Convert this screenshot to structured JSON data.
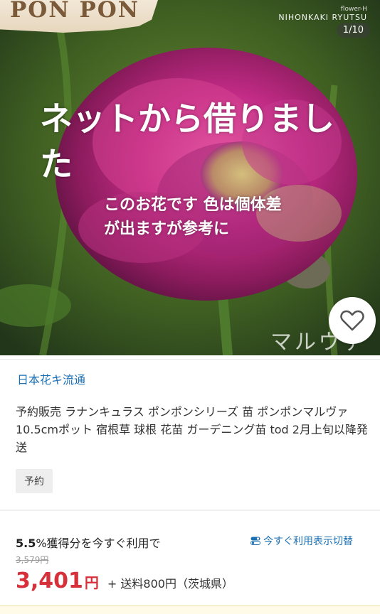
{
  "hero": {
    "brand": "PON PON",
    "shop_sub": "flower-H",
    "shop_name": "NIHONKAKI RYUTSU",
    "counter": "1/10",
    "overlay_big": "ネットから借りました",
    "overlay_small": "このお花です 色は個体差が出ますが参考に",
    "watermark": "マルヴァ",
    "fav_icon": "heart-icon"
  },
  "product": {
    "store_name": "日本花キ流通",
    "title": "予約販売 ラナンキュラス ポンポンシリーズ 苗 ポンポンマルヴァ 10.5cmポット 宿根草 球根 花苗 ガーデニング苗 tod 2月上旬以降発送",
    "badge": "予約"
  },
  "pricing": {
    "points_pct": "5.5",
    "points_text": "%獲得分を今すぐ利用で",
    "points_link": "今すぐ利用表示切替",
    "old_price": "3,579円",
    "price": "3,401",
    "yen": "円",
    "shipping": "+ 送料800円（茨城県）"
  },
  "colors": {
    "accent_blue": "#1b6fb3",
    "price_red": "#d6313b"
  }
}
